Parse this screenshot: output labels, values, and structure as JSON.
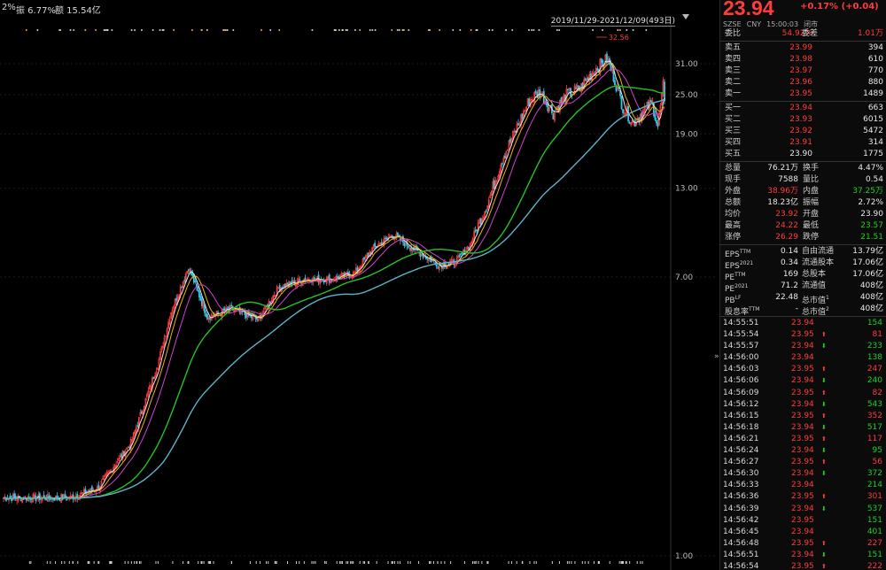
{
  "topbar": {
    "pct_fragment": "2%",
    "amplitude": "振 6.77%",
    "turnover": "额 15.54亿"
  },
  "range_label": "2019/11/29-2021/12/09(493日)",
  "collapse_glyph": "»",
  "colors": {
    "up": "#ff3b3b",
    "down": "#1fd11f",
    "ma5": "#e6e6e6",
    "ma10": "#f0b400",
    "ma20": "#d040d0",
    "ma60": "#22c322",
    "ma120": "#5ab4c8"
  },
  "chart_data": {
    "type": "candlestick",
    "y_scale": "log",
    "y_ticks": [
      "31.00",
      "25.00",
      "19.00",
      "13.00",
      "7.00",
      "1.00"
    ],
    "y_tick_values": [
      31,
      25,
      19,
      13,
      7,
      1
    ],
    "max_marker": "32.56",
    "date_range": [
      "2019/11/29",
      "2021/12/09"
    ],
    "trading_days": 493,
    "close_anchors": [
      {
        "i": 0,
        "v": 1.5
      },
      {
        "i": 30,
        "v": 1.5
      },
      {
        "i": 50,
        "v": 1.5
      },
      {
        "i": 70,
        "v": 1.6
      },
      {
        "i": 95,
        "v": 2.2
      },
      {
        "i": 115,
        "v": 3.8
      },
      {
        "i": 125,
        "v": 5.5
      },
      {
        "i": 138,
        "v": 7.5
      },
      {
        "i": 152,
        "v": 5.3
      },
      {
        "i": 170,
        "v": 5.6
      },
      {
        "i": 190,
        "v": 5.2
      },
      {
        "i": 205,
        "v": 6.5
      },
      {
        "i": 225,
        "v": 6.9
      },
      {
        "i": 245,
        "v": 6.9
      },
      {
        "i": 262,
        "v": 7.2
      },
      {
        "i": 275,
        "v": 8.5
      },
      {
        "i": 290,
        "v": 9.4
      },
      {
        "i": 310,
        "v": 8.3
      },
      {
        "i": 325,
        "v": 7.6
      },
      {
        "i": 338,
        "v": 7.8
      },
      {
        "i": 348,
        "v": 8.8
      },
      {
        "i": 362,
        "v": 12.0
      },
      {
        "i": 372,
        "v": 16.0
      },
      {
        "i": 382,
        "v": 19.5
      },
      {
        "i": 392,
        "v": 24.0
      },
      {
        "i": 400,
        "v": 25.5
      },
      {
        "i": 410,
        "v": 22.0
      },
      {
        "i": 420,
        "v": 25.0
      },
      {
        "i": 430,
        "v": 26.0
      },
      {
        "i": 440,
        "v": 29.5
      },
      {
        "i": 450,
        "v": 32.0
      },
      {
        "i": 455,
        "v": 28.5
      },
      {
        "i": 462,
        "v": 23.0
      },
      {
        "i": 470,
        "v": 20.5
      },
      {
        "i": 478,
        "v": 22.5
      },
      {
        "i": 484,
        "v": 23.5
      },
      {
        "i": 488,
        "v": 20.0
      },
      {
        "i": 492,
        "v": 26.5
      },
      {
        "i": 493,
        "v": 23.94
      }
    ]
  },
  "quote": {
    "price": "23.94",
    "change": "+0.17%",
    "change_abs": "(+0.04)",
    "exchange": "SZSE",
    "currency": "CNY",
    "time": "15:00:03",
    "status": "闭市"
  },
  "order_book": {
    "ratio_label": "委比",
    "ratio": "54.92%",
    "diff_label": "委差",
    "diff": "1.01万",
    "asks": [
      {
        "label": "卖五",
        "price": "23.99",
        "vol": "394"
      },
      {
        "label": "卖四",
        "price": "23.98",
        "vol": "610"
      },
      {
        "label": "卖三",
        "price": "23.97",
        "vol": "770"
      },
      {
        "label": "卖二",
        "price": "23.96",
        "vol": "880"
      },
      {
        "label": "卖一",
        "price": "23.95",
        "vol": "1489"
      }
    ],
    "bids": [
      {
        "label": "买一",
        "price": "23.94",
        "vol": "663"
      },
      {
        "label": "买二",
        "price": "23.93",
        "vol": "6015"
      },
      {
        "label": "买三",
        "price": "23.92",
        "vol": "5472"
      },
      {
        "label": "买四",
        "price": "23.91",
        "vol": "314"
      },
      {
        "label": "买五",
        "price": "23.90",
        "vol": "1775"
      }
    ]
  },
  "stats": [
    {
      "l1": "总量",
      "v1": "76.21万",
      "l2": "换手",
      "v2": "4.47%"
    },
    {
      "l1": "现手",
      "v1": "7588",
      "l2": "量比",
      "v2": "0.54"
    },
    {
      "l1": "外盘",
      "v1": "38.96万",
      "l2": "内盘",
      "v2": "37.25万"
    },
    {
      "l1": "总额",
      "v1": "18.23亿",
      "l2": "振幅",
      "v2": "2.72%"
    },
    {
      "l1": "均价",
      "v1": "23.92",
      "l2": "开盘",
      "v2": "23.90"
    },
    {
      "l1": "最高",
      "v1": "24.22",
      "l2": "最低",
      "v2": "23.57"
    },
    {
      "l1": "涨停",
      "v1": "26.29",
      "l2": "跌停",
      "v2": "21.51"
    }
  ],
  "fundamentals": [
    {
      "l1": "EPS",
      "s1": "TTM",
      "v1": "0.14",
      "l2": "自由流通",
      "v2": "13.79亿"
    },
    {
      "l1": "EPS",
      "s1": "2021",
      "v1": "0.34",
      "l2": "流通股本",
      "v2": "17.06亿"
    },
    {
      "l1": "PE",
      "s1": "TTM",
      "v1": "169",
      "l2": "总股本",
      "v2": "17.06亿"
    },
    {
      "l1": "PE",
      "s1": "2021",
      "v1": "71.2",
      "l2": "流通值",
      "v2": "408亿"
    },
    {
      "l1": "PB",
      "s1": "LF",
      "v1": "22.48",
      "l2": "总市值",
      "s2": "1",
      "v2": "408亿"
    },
    {
      "l1": "股息率",
      "s1": "TTM",
      "v1": "-",
      "l2": "总市值",
      "s2": "2",
      "v2": "408亿"
    }
  ],
  "ticks": [
    {
      "time": "14:55:51",
      "price": "23.94",
      "dir": "",
      "vol": "154"
    },
    {
      "time": "14:55:54",
      "price": "23.95",
      "dir": "up",
      "vol": "81"
    },
    {
      "time": "14:55:57",
      "price": "23.94",
      "dir": "down",
      "vol": "233"
    },
    {
      "time": "14:56:00",
      "price": "23.94",
      "dir": "",
      "vol": "138"
    },
    {
      "time": "14:56:03",
      "price": "23.95",
      "dir": "up",
      "vol": "247"
    },
    {
      "time": "14:56:06",
      "price": "23.94",
      "dir": "down",
      "vol": "240"
    },
    {
      "time": "14:56:09",
      "price": "23.95",
      "dir": "up",
      "vol": "82"
    },
    {
      "time": "14:56:12",
      "price": "23.94",
      "dir": "down",
      "vol": "543"
    },
    {
      "time": "14:56:15",
      "price": "23.95",
      "dir": "up",
      "vol": "352"
    },
    {
      "time": "14:56:18",
      "price": "23.94",
      "dir": "down",
      "vol": "517"
    },
    {
      "time": "14:56:21",
      "price": "23.95",
      "dir": "up",
      "vol": "117"
    },
    {
      "time": "14:56:24",
      "price": "23.94",
      "dir": "down",
      "vol": "95"
    },
    {
      "time": "14:56:27",
      "price": "23.95",
      "dir": "up",
      "vol": "56"
    },
    {
      "time": "14:56:30",
      "price": "23.94",
      "dir": "down",
      "vol": "372"
    },
    {
      "time": "14:56:33",
      "price": "23.94",
      "dir": "",
      "vol": "214"
    },
    {
      "time": "14:56:36",
      "price": "23.95",
      "dir": "up",
      "vol": "301"
    },
    {
      "time": "14:56:39",
      "price": "23.94",
      "dir": "down",
      "vol": "537"
    },
    {
      "time": "14:56:42",
      "price": "23.95",
      "dir": "",
      "vol": "151"
    },
    {
      "time": "14:56:45",
      "price": "23.94",
      "dir": "",
      "vol": "401"
    },
    {
      "time": "14:56:48",
      "price": "23.95",
      "dir": "up",
      "vol": "227"
    },
    {
      "time": "14:56:51",
      "price": "23.94",
      "dir": "down",
      "vol": "151"
    },
    {
      "time": "14:56:54",
      "price": "23.95",
      "dir": "up",
      "vol": "222"
    }
  ]
}
